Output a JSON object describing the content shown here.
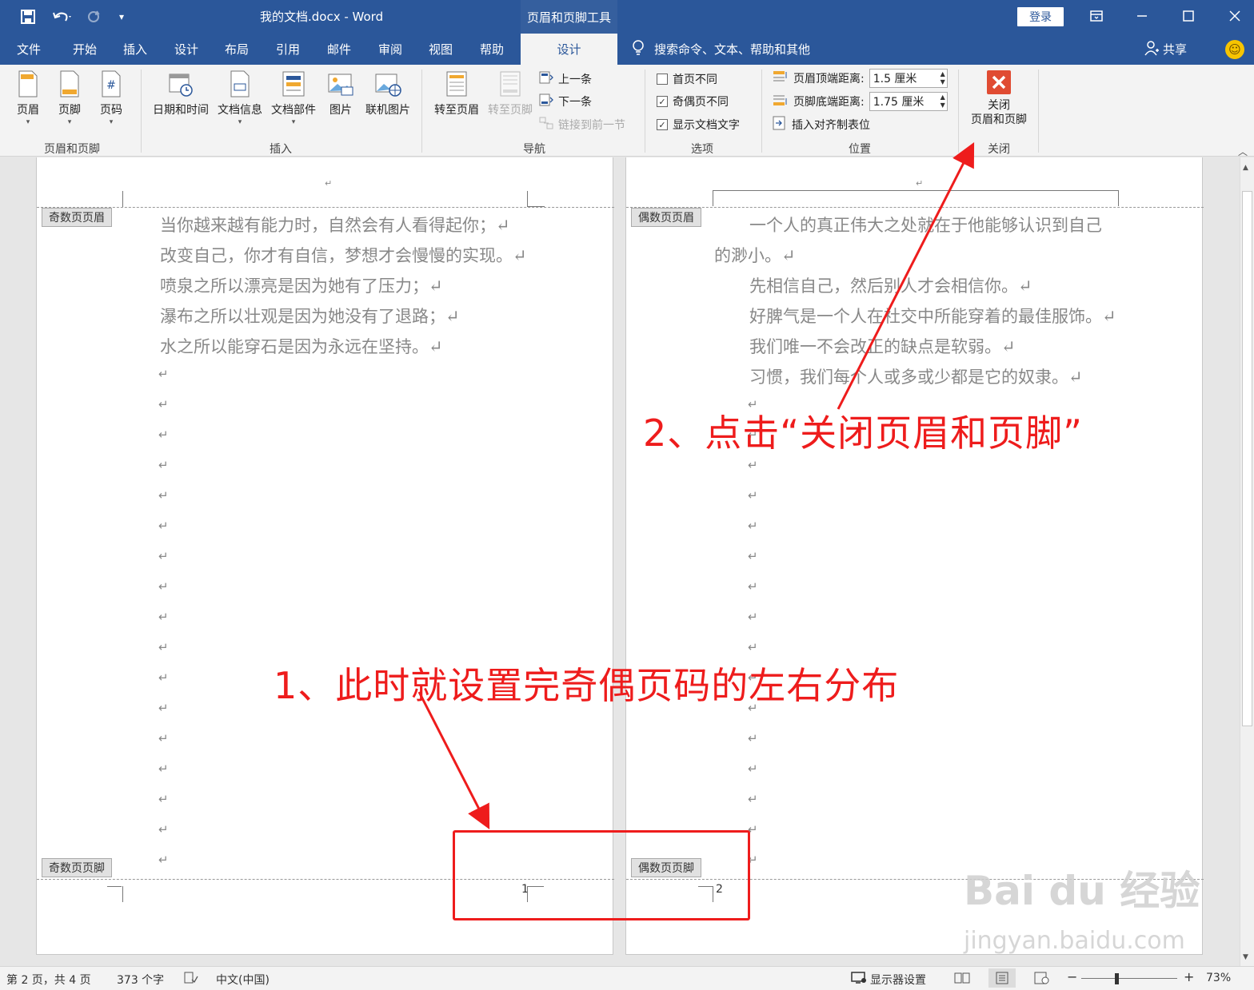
{
  "title_bar": {
    "doc_title": "我的文档.docx  -  Word",
    "context_tool": "页眉和页脚工具",
    "login": "登录"
  },
  "tabs": {
    "file": "文件",
    "home": "开始",
    "insert": "插入",
    "design": "设计",
    "layout": "布局",
    "references": "引用",
    "mailings": "邮件",
    "review": "审阅",
    "view": "视图",
    "help": "帮助",
    "hf_design": "设计",
    "tell_me": "搜索命令、文本、帮助和其他",
    "share": "共享"
  },
  "ribbon": {
    "header": "页眉",
    "footer": "页脚",
    "page_number": "页码",
    "group_hf": "页眉和页脚",
    "date_time": "日期和时间",
    "doc_info": "文档信息",
    "quick_parts": "文档部件",
    "pictures": "图片",
    "online_pictures": "联机图片",
    "group_insert": "插入",
    "goto_header": "转至页眉",
    "goto_footer": "转至页脚",
    "previous": "上一条",
    "next": "下一条",
    "link_previous": "链接到前一节",
    "group_nav": "导航",
    "different_first": "首页不同",
    "different_odd_even": "奇偶页不同",
    "show_doc_text": "显示文档文字",
    "group_options": "选项",
    "header_top_label": "页眉顶端距离:",
    "header_top_value": "1.5 厘米",
    "footer_bottom_label": "页脚底端距离:",
    "footer_bottom_value": "1.75 厘米",
    "insert_align_tab": "插入对齐制表位",
    "group_position": "位置",
    "close_line1": "关闭",
    "close_line2": "页眉和页脚",
    "group_close": "关闭"
  },
  "page_left": {
    "header_tag": "奇数页页眉",
    "footer_tag": "奇数页页脚",
    "lines": [
      "当你越来越有能力时，自然会有人看得起你；↵",
      "改变自己，你才有自信，梦想才会慢慢的实现。↵",
      "喷泉之所以漂亮是因为她有了压力；↵",
      "瀑布之所以壮观是因为她没有了退路；↵",
      "水之所以能穿石是因为永远在坚持。↵"
    ],
    "page_number": "1"
  },
  "page_right": {
    "header_tag": "偶数页页眉",
    "footer_tag": "偶数页页脚",
    "lines": [
      "一个人的真正伟大之处就在于他能够认识到自己",
      "的渺小。↵",
      "先相信自己，然后别人才会相信你。↵",
      "好脾气是一个人在社交中所能穿着的最佳服饰。↵",
      "我们唯一不会改正的缺点是软弱。↵",
      "习惯，我们每个人或多或少都是它的奴隶。↵"
    ],
    "page_number": "2"
  },
  "paragraph_mark": "↵",
  "annotations": {
    "step1": "1、此时就设置完奇偶页码的左右分布",
    "step2": "2、点击“关闭页眉和页脚”"
  },
  "status_bar": {
    "page": "第 2 页，共 4 页",
    "words": "373 个字",
    "language": "中文(中国)",
    "display_settings": "显示器设置",
    "zoom": "73%"
  },
  "watermark": {
    "brand": "Bai du 经验",
    "url": "jingyan.baidu.com"
  },
  "colors": {
    "ribbon_blue": "#2b579a",
    "annotation_red": "#ee1c1c",
    "close_icon_red": "#e04b32"
  }
}
